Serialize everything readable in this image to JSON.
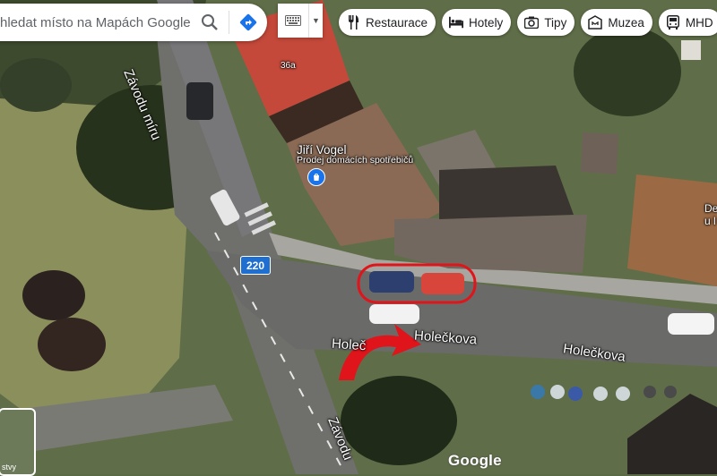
{
  "search": {
    "placeholder": "hledat místo na Mapách Google"
  },
  "chips": [
    {
      "label": "Restaurace",
      "icon": "fork-knife-icon"
    },
    {
      "label": "Hotely",
      "icon": "bed-icon"
    },
    {
      "label": "Tipy",
      "icon": "camera-icon"
    },
    {
      "label": "Muzea",
      "icon": "museum-icon"
    },
    {
      "label": "MHD",
      "icon": "bus-icon"
    }
  ],
  "map": {
    "street_labels": {
      "zavodu_miru_top": "Závodu míru",
      "zavodu_miru_bottom": "Závodu",
      "holeckova_left": "Holeč",
      "holeckova_center": "Holečkova",
      "holeckova_right": "Holečkova"
    },
    "route_number": "220",
    "house_number": "36a",
    "poi": {
      "name": "Jiří Vogel",
      "subtitle": "Prodej domácích spotřebičů",
      "icon": "shopping-bag-icon"
    },
    "edge_labels": {
      "right_top": "De",
      "right_bottom": "u l"
    },
    "attribution": "Google",
    "layers_label": "stvy"
  },
  "colors": {
    "accent_blue": "#1a73e8",
    "annotation_red": "#e0141b",
    "route_badge": "#1f6fd1"
  }
}
